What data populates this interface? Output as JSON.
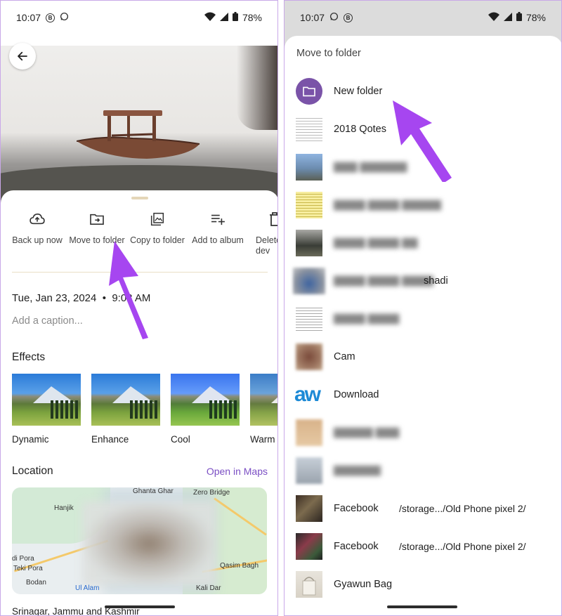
{
  "colors": {
    "accent": "#7b4fc4",
    "new_folder_icon_bg": "#7a53a8",
    "annotation_arrow": "#a646f0"
  },
  "left": {
    "status": {
      "time": "10:07",
      "battery": "78%",
      "notification_icons": [
        "b-circle-icon",
        "whatsapp-icon"
      ]
    },
    "actions": [
      {
        "icon": "cloud-upload-icon",
        "label": "Back up now"
      },
      {
        "icon": "move-to-folder-icon",
        "label": "Move to folder"
      },
      {
        "icon": "copy-to-folder-icon",
        "label": "Copy to folder"
      },
      {
        "icon": "add-to-album-icon",
        "label": "Add to album"
      },
      {
        "icon": "delete-icon",
        "label": "Delete dev"
      }
    ],
    "date": "Tue, Jan 23, 2024",
    "time_taken": "9:08 AM",
    "caption_placeholder": "Add a caption...",
    "effects_title": "Effects",
    "effects": [
      "Dynamic",
      "Enhance",
      "Cool",
      "Warm"
    ],
    "location_title": "Location",
    "open_in_maps": "Open in Maps",
    "map_labels": [
      "Ghanta Ghar",
      "Zero Bridge",
      "Hanjik",
      "di Pora",
      "Teki Pora",
      "Bodan",
      "Ul Alam",
      "Qasim Bagh",
      "Kali Dar"
    ],
    "place": "Srinagar, Jammu and Kashmir"
  },
  "right": {
    "status": {
      "time": "10:07",
      "battery": "78%"
    },
    "sheet_title": "Move to folder",
    "folders": [
      {
        "name": "New folder",
        "path": "",
        "blurred": false
      },
      {
        "name": "2018 Qotes",
        "path": "",
        "blurred": false
      },
      {
        "name": "",
        "path": "",
        "blurred": true
      },
      {
        "name": "",
        "path": "",
        "blurred": true
      },
      {
        "name": "",
        "path": "",
        "blurred": true
      },
      {
        "name": "shadi",
        "path": "",
        "blurred": true
      },
      {
        "name": "",
        "path": "",
        "blurred": true
      },
      {
        "name": "Cam",
        "path": "",
        "blurred": false
      },
      {
        "name": "Download",
        "path": "",
        "blurred": false
      },
      {
        "name": "",
        "path": "",
        "blurred": true
      },
      {
        "name": "",
        "path": "",
        "blurred": true
      },
      {
        "name": "Facebook",
        "path": "/storage.../Old Phone pixel 2/",
        "blurred": false
      },
      {
        "name": "Facebook",
        "path": "/storage.../Old Phone pixel 2/",
        "blurred": false
      },
      {
        "name": "Gyawun Bag",
        "path": "",
        "blurred": false
      }
    ]
  }
}
